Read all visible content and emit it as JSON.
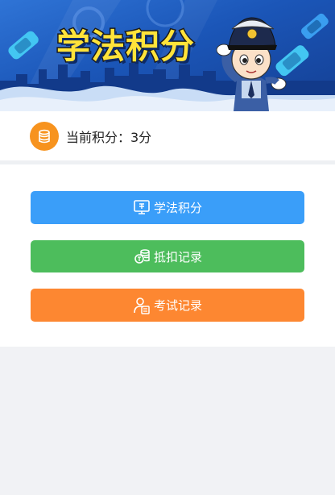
{
  "banner": {
    "title": "学法积分"
  },
  "points": {
    "label": "当前积分：3分",
    "icon": "coin-stack-icon",
    "icon_color": "#f7931e"
  },
  "menu": {
    "items": [
      {
        "label": "学法积分",
        "icon": "monitor-icon",
        "color": "#3a9ef9"
      },
      {
        "label": "抵扣记录",
        "icon": "coins-icon",
        "color": "#4dbd5c"
      },
      {
        "label": "考试记录",
        "icon": "exam-person-icon",
        "color": "#fd8731"
      }
    ]
  }
}
